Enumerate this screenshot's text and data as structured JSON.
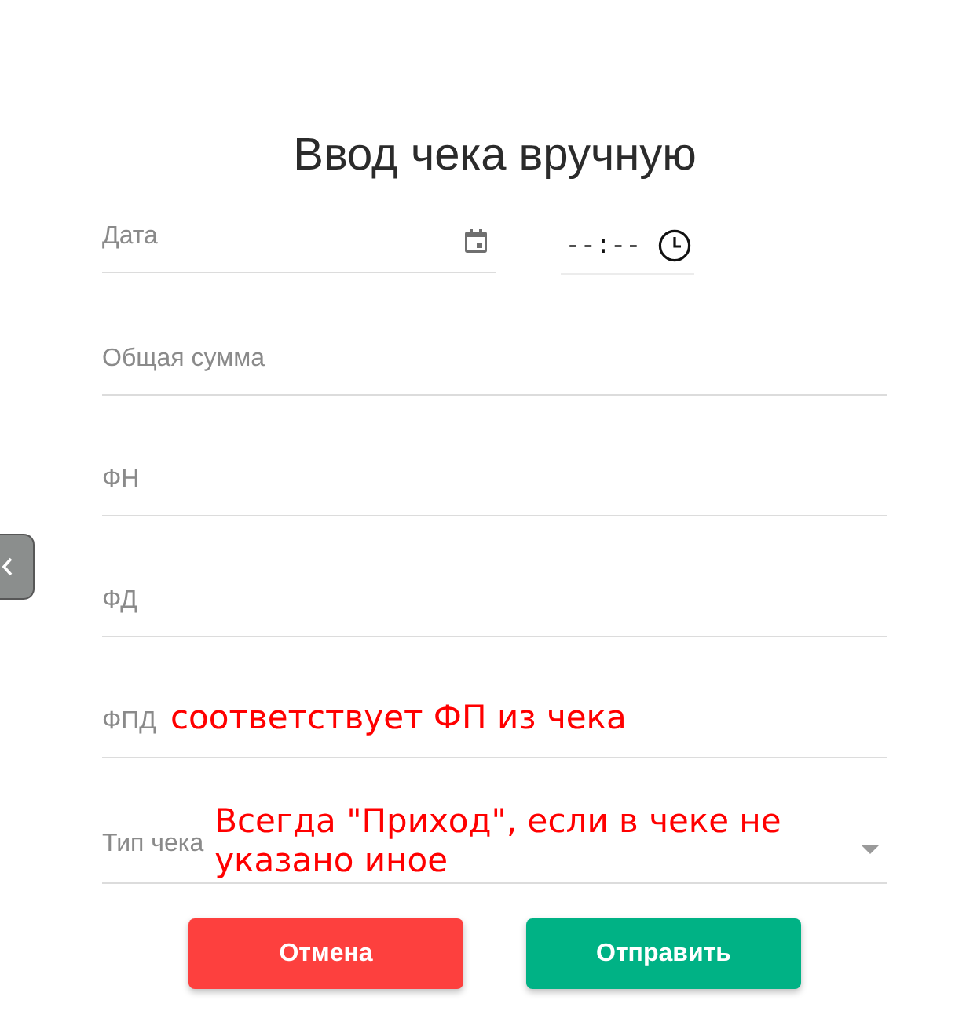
{
  "dialog": {
    "title": "Ввод чека вручную"
  },
  "date_row": {
    "date": {
      "placeholder": "Дата"
    },
    "time": {
      "value": "--:--"
    }
  },
  "fields": [
    {
      "kind": "text",
      "placeholder": "Общая сумма"
    },
    {
      "kind": "text",
      "placeholder": "ФН"
    },
    {
      "kind": "text",
      "placeholder": "ФД"
    },
    {
      "kind": "text",
      "placeholder": "ФПД",
      "note": "соответствует ФП из чека"
    },
    {
      "kind": "select",
      "placeholder": "Тип чека",
      "note": "Всегда \"Приход\", если в чеке не указано иное"
    }
  ],
  "buttons": [
    {
      "kind": "cancel",
      "label": "Отмена"
    },
    {
      "kind": "submit",
      "label": "Отправить"
    }
  ]
}
